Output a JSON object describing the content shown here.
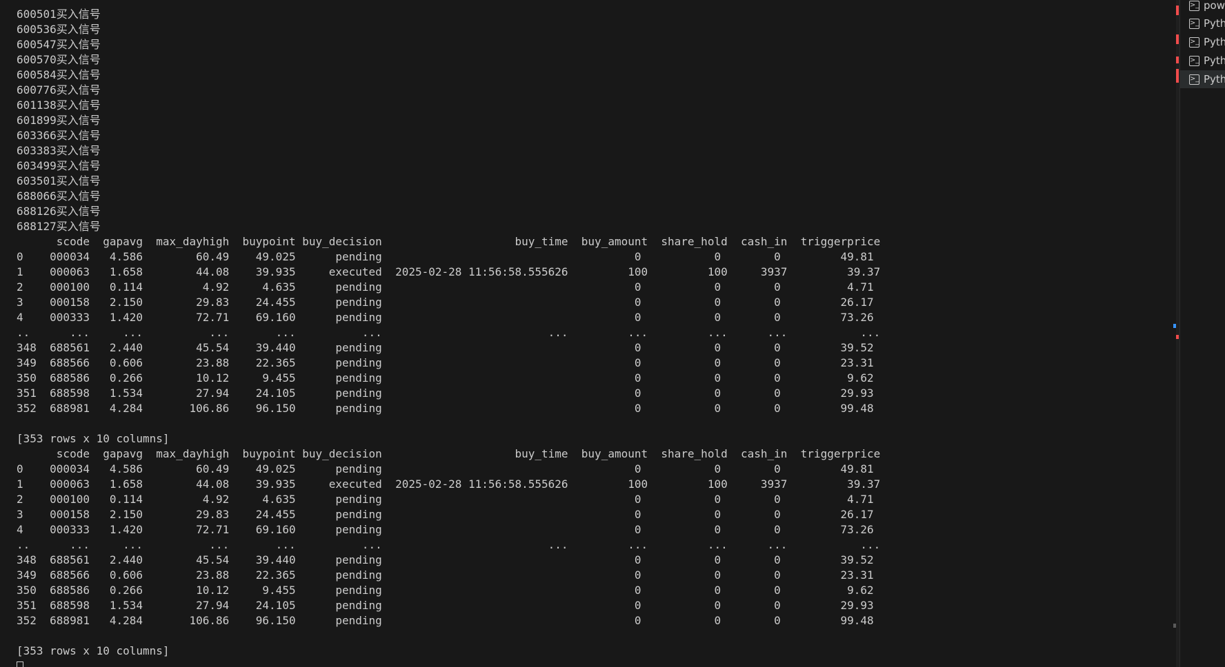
{
  "terminal": {
    "lines": [
      "600501买入信号",
      "600536买入信号",
      "600547买入信号",
      "600570买入信号",
      "600584买入信号",
      "600776买入信号",
      "601138买入信号",
      "601899买入信号",
      "603366买入信号",
      "603383买入信号",
      "603499买入信号",
      "603501买入信号",
      "688066买入信号",
      "688126买入信号",
      "688127买入信号",
      "      scode  gapavg  max_dayhigh  buypoint buy_decision                    buy_time  buy_amount  share_hold  cash_in  triggerprice",
      "0    000034   4.586        60.49    49.025      pending                                      0           0        0         49.81",
      "1    000063   1.658        44.08    39.935     executed  2025-02-28 11:56:58.555626         100         100     3937         39.37",
      "2    000100   0.114         4.92     4.635      pending                                      0           0        0          4.71",
      "3    000158   2.150        29.83    24.455      pending                                      0           0        0         26.17",
      "4    000333   1.420        72.71    69.160      pending                                      0           0        0         73.26",
      "..      ...     ...          ...       ...          ...                         ...         ...         ...      ...           ...",
      "348  688561   2.440        45.54    39.440      pending                                      0           0        0         39.52",
      "349  688566   0.606        23.88    22.365      pending                                      0           0        0         23.31",
      "350  688586   0.266        10.12     9.455      pending                                      0           0        0          9.62",
      "351  688598   1.534        27.94    24.105      pending                                      0           0        0         29.93",
      "352  688981   4.284       106.86    96.150      pending                                      0           0        0         99.48",
      "",
      "[353 rows x 10 columns]",
      "      scode  gapavg  max_dayhigh  buypoint buy_decision                    buy_time  buy_amount  share_hold  cash_in  triggerprice",
      "0    000034   4.586        60.49    49.025      pending                                      0           0        0         49.81",
      "1    000063   1.658        44.08    39.935     executed  2025-02-28 11:56:58.555626         100         100     3937         39.37",
      "2    000100   0.114         4.92     4.635      pending                                      0           0        0          4.71",
      "3    000158   2.150        29.83    24.455      pending                                      0           0        0         26.17",
      "4    000333   1.420        72.71    69.160      pending                                      0           0        0         73.26",
      "..      ...     ...          ...       ...          ...                         ...         ...         ...      ...           ...",
      "348  688561   2.440        45.54    39.440      pending                                      0           0        0         39.52",
      "349  688566   0.606        23.88    22.365      pending                                      0           0        0         23.31",
      "350  688586   0.266        10.12     9.455      pending                                      0           0        0          9.62",
      "351  688598   1.534        27.94    24.105      pending                                      0           0        0         29.93",
      "352  688981   4.284       106.86    96.150      pending                                      0           0        0         99.48",
      "",
      "[353 rows x 10 columns]"
    ]
  },
  "panel": {
    "tabs": [
      {
        "label": "pow",
        "icon": "terminal-icon",
        "active": false
      },
      {
        "label": "Pyth",
        "icon": "terminal-icon",
        "active": false
      },
      {
        "label": "Pyth",
        "icon": "terminal-icon",
        "active": false
      },
      {
        "label": "Pyth",
        "icon": "terminal-icon",
        "active": false
      },
      {
        "label": "Pyth",
        "icon": "terminal-icon",
        "active": true
      }
    ]
  },
  "colors": {
    "background": "#181818",
    "text": "#cccccc",
    "error_marker": "#f14c4c",
    "info_marker": "#3794ff",
    "gray_marker": "#5a5a5a"
  }
}
